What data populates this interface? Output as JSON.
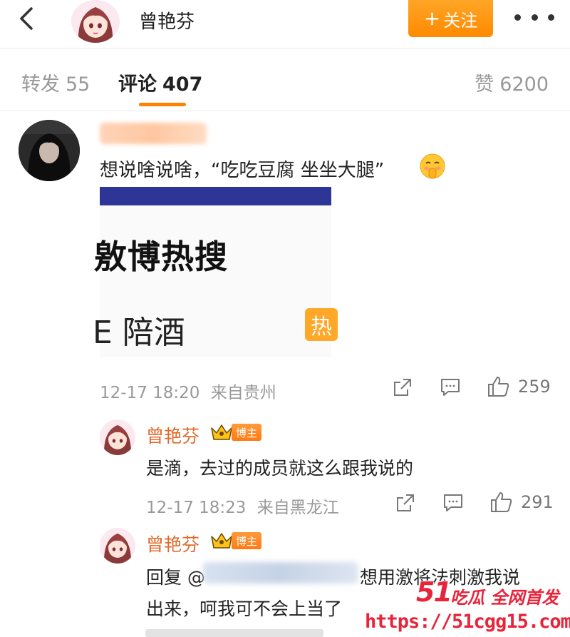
{
  "header": {
    "username": "曾艳芬",
    "follow_label": "关注",
    "follow_plus": "+"
  },
  "tabs": {
    "repost": {
      "label": "转发",
      "count": "55"
    },
    "comment": {
      "label": "评论",
      "count": "407"
    },
    "like": {
      "label": "赞",
      "count": "6200"
    }
  },
  "comment": {
    "text": "想说啥说啥，“吃吃豆腐 坐坐大腿”",
    "embed": {
      "title": "敫博热搜",
      "topic": "E 陪酒",
      "hot_label": "热"
    },
    "time": "12-17 18:20",
    "location": "来自贵州",
    "likes": "259"
  },
  "replies": [
    {
      "username": "曾艳芬",
      "badge": "博主",
      "text": "是滴，去过的成员就这么跟我说的",
      "time": "12-17 18:23",
      "location": "来自黑龙江",
      "likes": "291"
    },
    {
      "username": "曾艳芬",
      "badge": "博主",
      "reply_prefix": "回复 @",
      "text_line1_after": "想用激将法刺激我说",
      "text_line2": "出来，呵我可不会上当了"
    }
  ],
  "watermark": {
    "num": "51",
    "slogan": "吃瓜 全网首发",
    "url": "https://51cgg15.com"
  },
  "colors": {
    "accent_orange": "#ff8200",
    "reply_name": "#e06a2c",
    "watermark_red": "#e8243b",
    "embed_bar": "#2d3696"
  }
}
